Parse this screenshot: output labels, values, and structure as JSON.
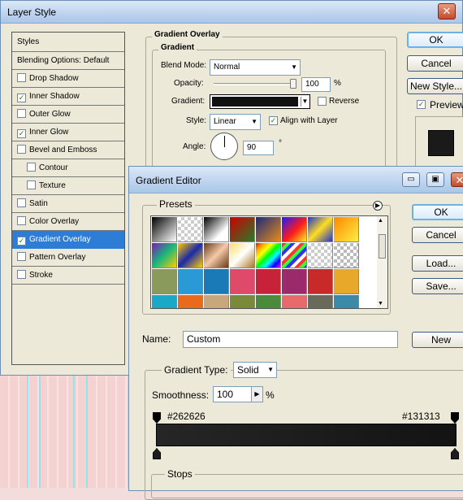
{
  "layer_style": {
    "title": "Layer Style",
    "styles_header": "Styles",
    "items": [
      {
        "label": "Blending Options: Default",
        "checkbox": false
      },
      {
        "label": "Drop Shadow",
        "checkbox": true,
        "checked": false
      },
      {
        "label": "Inner Shadow",
        "checkbox": true,
        "checked": true
      },
      {
        "label": "Outer Glow",
        "checkbox": true,
        "checked": false
      },
      {
        "label": "Inner Glow",
        "checkbox": true,
        "checked": true
      },
      {
        "label": "Bevel and Emboss",
        "checkbox": true,
        "checked": false
      },
      {
        "label": "Contour",
        "checkbox": true,
        "checked": false,
        "indent": true
      },
      {
        "label": "Texture",
        "checkbox": true,
        "checked": false,
        "indent": true
      },
      {
        "label": "Satin",
        "checkbox": true,
        "checked": false
      },
      {
        "label": "Color Overlay",
        "checkbox": true,
        "checked": false
      },
      {
        "label": "Gradient Overlay",
        "checkbox": true,
        "checked": true,
        "selected": true
      },
      {
        "label": "Pattern Overlay",
        "checkbox": true,
        "checked": false
      },
      {
        "label": "Stroke",
        "checkbox": true,
        "checked": false
      }
    ],
    "section_title": "Gradient Overlay",
    "subsection_title": "Gradient",
    "blend_mode_label": "Blend Mode:",
    "blend_mode_value": "Normal",
    "opacity_label": "Opacity:",
    "opacity_value": "100",
    "opacity_percent": 100,
    "percent_sign": "%",
    "gradient_label": "Gradient:",
    "reverse_label": "Reverse",
    "style_label": "Style:",
    "style_value": "Linear",
    "align_label": "Align with Layer",
    "angle_label": "Angle:",
    "angle_value": "90",
    "degree_sign": "°",
    "ok_label": "OK",
    "cancel_label": "Cancel",
    "new_style_label": "New Style...",
    "preview_label": "Preview"
  },
  "gradient_editor": {
    "title": "Gradient Editor",
    "presets_label": "Presets",
    "ok_label": "OK",
    "cancel_label": "Cancel",
    "load_label": "Load...",
    "save_label": "Save...",
    "name_label": "Name:",
    "name_value": "Custom",
    "new_label": "New",
    "gradient_type_label": "Gradient Type:",
    "gradient_type_value": "Solid",
    "smoothness_label": "Smoothness:",
    "smoothness_value": "100",
    "percent_sign": "%",
    "left_color": "#262626",
    "right_color": "#131313",
    "stops_label": "Stops",
    "window_buttons": {
      "minimize": "▭",
      "maximize": "▣",
      "close": "✕"
    }
  },
  "colors": {
    "selection": "#2d7cd6",
    "gradient_start": "#262626",
    "gradient_end": "#131313"
  }
}
